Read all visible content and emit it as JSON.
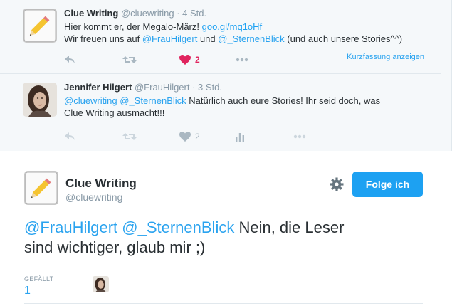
{
  "thread": {
    "tweets": [
      {
        "name": "Clue Writing",
        "handle": "@cluewriting",
        "time": "· 4 Std.",
        "line1_text": "Hier kommt er, der Megalo-März! ",
        "line1_link": "goo.gl/mq1oHf",
        "line2_a": "Wir freuen uns auf ",
        "line2_m1": "@FrauHilgert",
        "line2_b": " und ",
        "line2_m2": "@_SternenBlick",
        "line2_c": " (und auch unsere Stories^^)",
        "likes": "2",
        "expand_label": "Kurzfassung anzeigen"
      },
      {
        "name": "Jennifer Hilgert",
        "handle": "@FrauHilgert",
        "time": "· 3 Std.",
        "m1": "@cluewriting",
        "m2": "@_SternenBlick",
        "text_a": " Natürlich auch eure Stories! Ihr seid doch, was",
        "text_b": "Clue Writing ausmacht!!!",
        "likes": "2"
      }
    ]
  },
  "main": {
    "name": "Clue Writing",
    "handle": "@cluewriting",
    "follow_label": "Folge ich",
    "m1": "@FrauHilgert",
    "m2": "@_SternenBlick",
    "text_a": " Nein, die Leser",
    "text_b": "sind wichtiger, glaub mir ;)",
    "likes_label": "GEFÄLLT",
    "likes_count": "1"
  },
  "colors": {
    "accent": "#1da1f2",
    "like": "#e0245e",
    "muted": "#8899a6"
  },
  "icons": [
    "pencil-logo-icon",
    "reply-icon",
    "retweet-icon",
    "heart-icon",
    "more-icon",
    "analytics-icon",
    "gear-icon"
  ]
}
